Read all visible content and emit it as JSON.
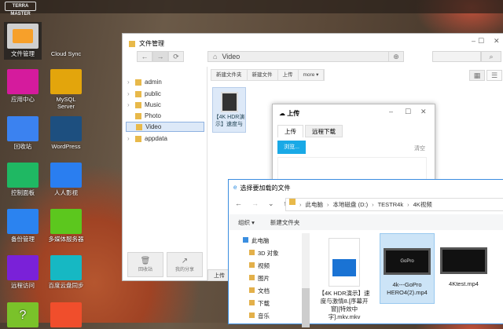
{
  "desktop": {
    "logo": "TERRA MASTER",
    "apps": [
      {
        "label": "文件管理",
        "color": "#cfcfcf",
        "icon": "folder-icon"
      },
      {
        "label": "Cloud Sync",
        "color": "transparent",
        "icon": "cloud-sync-icon"
      },
      {
        "label": "应用中心",
        "color": "#d51b9d",
        "icon": "bag-icon"
      },
      {
        "label": "MySQL Server",
        "color": "#e3a50c",
        "icon": "mariadb-icon"
      },
      {
        "label": "回收站",
        "color": "#3b82f0",
        "icon": "recycle-icon"
      },
      {
        "label": "WordPress",
        "color": "#1d4f7f",
        "icon": "wordpress-icon"
      },
      {
        "label": "控制面板",
        "color": "#1fb863",
        "icon": "sliders-icon"
      },
      {
        "label": "人人影视",
        "color": "#2a7ef0",
        "icon": "wave-icon"
      },
      {
        "label": "备份管理",
        "color": "#2b83f0",
        "icon": "history-icon"
      },
      {
        "label": "多媒体服务器",
        "color": "#5cc71e",
        "icon": "play-icon"
      },
      {
        "label": "远程访问",
        "color": "#7a21d8",
        "icon": "cloud-icon"
      },
      {
        "label": "百度云盘同步",
        "color": "#16b8c3",
        "icon": "baidu-icon"
      },
      {
        "label": "?",
        "color": "#7ac22a",
        "icon": "help-icon"
      },
      {
        "label": "",
        "color": "#f04e2c",
        "icon": "box-icon"
      }
    ]
  },
  "file_manager": {
    "title": "文件管理",
    "path": "Video",
    "tree": [
      "admin",
      "public",
      "Music",
      "Photo",
      "Video",
      "appdata"
    ],
    "actions": [
      "新建文件夹",
      "新建文件",
      "上传",
      "more ▾"
    ],
    "file": "【4K HDR演示】速度与",
    "bottom": [
      "回收站",
      "我的分享"
    ],
    "upload_strip": "上传"
  },
  "upload_dialog": {
    "title": "上传",
    "tabs": [
      "上传",
      "远程下载"
    ],
    "browse": "浏览...",
    "clear": "清空"
  },
  "file_dialog": {
    "title": "选择要加载的文件",
    "breadcrumb": [
      "此电脑",
      "本地磁盘 (D:)",
      "TESTR4k",
      "4K视频"
    ],
    "organize": "组织 ▾",
    "new_folder": "新建文件夹",
    "nav": [
      "此电脑",
      "3D 对象",
      "视频",
      "图片",
      "文档",
      "下载",
      "音乐"
    ],
    "files": [
      "【4K HDR演示】速度与激情8.[序幕开窗][特效中字].mkv.mkv",
      "4k---GoPro HERO4(2).mp4",
      "4Ktest.mp4"
    ]
  }
}
